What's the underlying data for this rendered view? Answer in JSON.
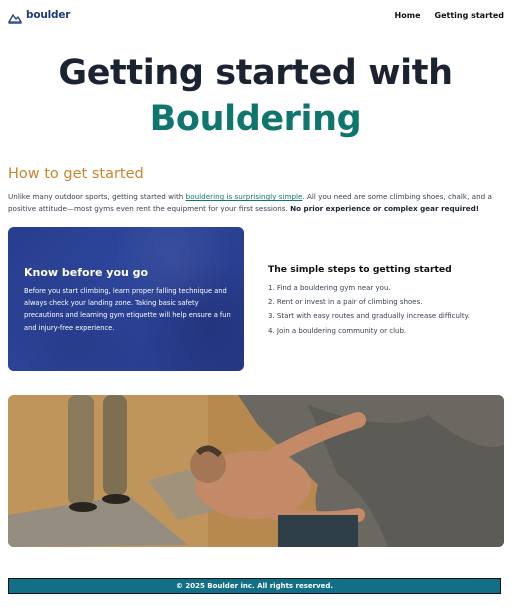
{
  "nav": {
    "logo_text": "boulder",
    "links": [
      "Home",
      "Getting started"
    ]
  },
  "hero": {
    "line1": "Getting started with",
    "line2": "Bouldering"
  },
  "intro": {
    "title": "How to get started",
    "text_before_link": "Unlike many outdoor sports, getting started with ",
    "link_text": "bouldering is surprisingly simple",
    "text_after_link": ". All you need are some climbing shoes, chalk, and a positive attitude—most gyms even rent the equipment for your first sessions. ",
    "bold_text": "No prior experience or complex gear required!"
  },
  "card": {
    "title": "Know before you go",
    "body": "Before you start climbing, learn proper falling technique and always check your landing zone. Taking basic safety precautions and learning gym etiquette will help ensure a fun and injury-free experience."
  },
  "steps": {
    "title": "The simple steps to getting started",
    "items": [
      "1. Find a bouldering gym near you.",
      "2. Rent or invest in a pair of climbing shoes.",
      "3. Start with easy routes and gradually increase difficulty.",
      "4. Join a bouldering community or club."
    ]
  },
  "photo": {
    "icon": "climber-photo"
  },
  "footer": {
    "text": "© 2025 Boulder inc. All rights reserved."
  },
  "colors": {
    "brand_navy": "#1f3a7a",
    "accent_teal": "#0f766e",
    "heading_gold": "#c9862a",
    "footer_bg": "#116f86"
  }
}
